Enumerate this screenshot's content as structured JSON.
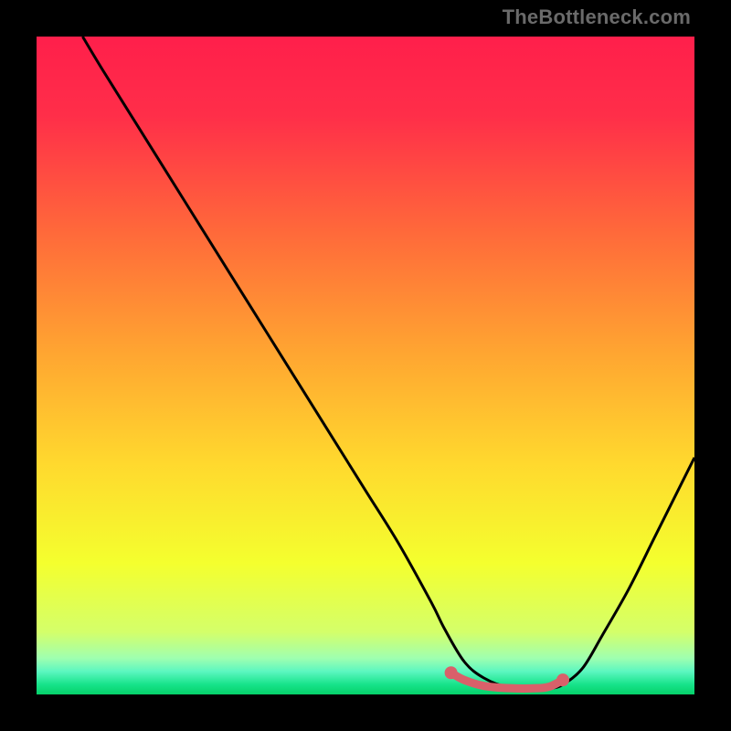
{
  "watermark": "TheBottleneck.com",
  "chart_data": {
    "type": "line",
    "title": "",
    "xlabel": "",
    "ylabel": "",
    "xlim": [
      0,
      100
    ],
    "ylim": [
      0,
      100
    ],
    "grid": false,
    "legend": false,
    "series": [
      {
        "name": "bottleneck-curve",
        "x": [
          7,
          10,
          15,
          20,
          25,
          30,
          35,
          40,
          45,
          50,
          55,
          60,
          62,
          65,
          68,
          72,
          76,
          78,
          80,
          83,
          86,
          90,
          94,
          98,
          100
        ],
        "values": [
          100,
          95,
          87,
          79,
          71,
          63,
          55,
          47,
          39,
          31,
          23,
          14,
          10,
          5,
          2.5,
          1.0,
          0.9,
          0.9,
          1.5,
          4,
          9,
          16,
          24,
          32,
          36
        ]
      }
    ],
    "highlight": {
      "name": "optimal-range",
      "x": [
        63,
        65,
        68,
        72,
        76,
        78,
        80
      ],
      "values": [
        3.3,
        2.2,
        1.3,
        0.95,
        0.95,
        1.2,
        2.2
      ],
      "endpoints": [
        {
          "x": 63,
          "y": 3.3
        },
        {
          "x": 80,
          "y": 2.2
        }
      ]
    },
    "background_gradient": {
      "stops": [
        {
          "offset": 0.0,
          "color": "#ff1f4b"
        },
        {
          "offset": 0.12,
          "color": "#ff2e49"
        },
        {
          "offset": 0.3,
          "color": "#ff6a3a"
        },
        {
          "offset": 0.48,
          "color": "#ffa531"
        },
        {
          "offset": 0.65,
          "color": "#ffd92e"
        },
        {
          "offset": 0.8,
          "color": "#f4ff2e"
        },
        {
          "offset": 0.905,
          "color": "#d4ff6a"
        },
        {
          "offset": 0.945,
          "color": "#9fffb0"
        },
        {
          "offset": 0.965,
          "color": "#5cf7c0"
        },
        {
          "offset": 0.985,
          "color": "#17e38a"
        },
        {
          "offset": 1.0,
          "color": "#05d169"
        }
      ]
    },
    "colors": {
      "curve": "#000000",
      "highlight": "#d9606a"
    }
  }
}
